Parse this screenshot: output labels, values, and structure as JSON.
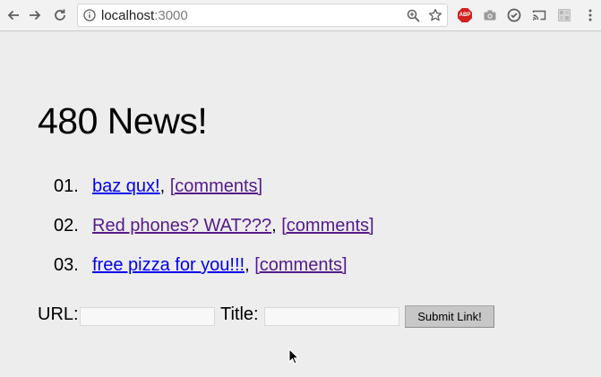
{
  "browser": {
    "url_host": "localhost",
    "url_port": ":3000",
    "icons": [
      "back-icon",
      "forward-icon",
      "reload-icon",
      "info-icon",
      "zoom-icon",
      "star-icon",
      "adblock-icon",
      "camera-icon",
      "sync-icon",
      "cast-icon",
      "extension-icon",
      "menu-icon"
    ],
    "abp_label": "ABP"
  },
  "page": {
    "title": "480 News!",
    "items": [
      {
        "number": "01.",
        "title": "baz qux!",
        "separator": ",",
        "comments": "[comments]",
        "title_visited": false
      },
      {
        "number": "02.",
        "title": "Red phones? WAT???",
        "separator": ",",
        "comments": "[comments]",
        "title_visited": true
      },
      {
        "number": "03.",
        "title": "free pizza for you!!!",
        "separator": ",",
        "comments": "[comments]",
        "title_visited": false
      }
    ],
    "form": {
      "url_label": "URL:",
      "url_value": "",
      "title_label": "Title:",
      "title_value": "",
      "submit_label": "Submit Link!"
    }
  },
  "colors": {
    "link_unvisited": "#0000ee",
    "link_visited": "#551a8b",
    "page_background": "#ededed"
  }
}
